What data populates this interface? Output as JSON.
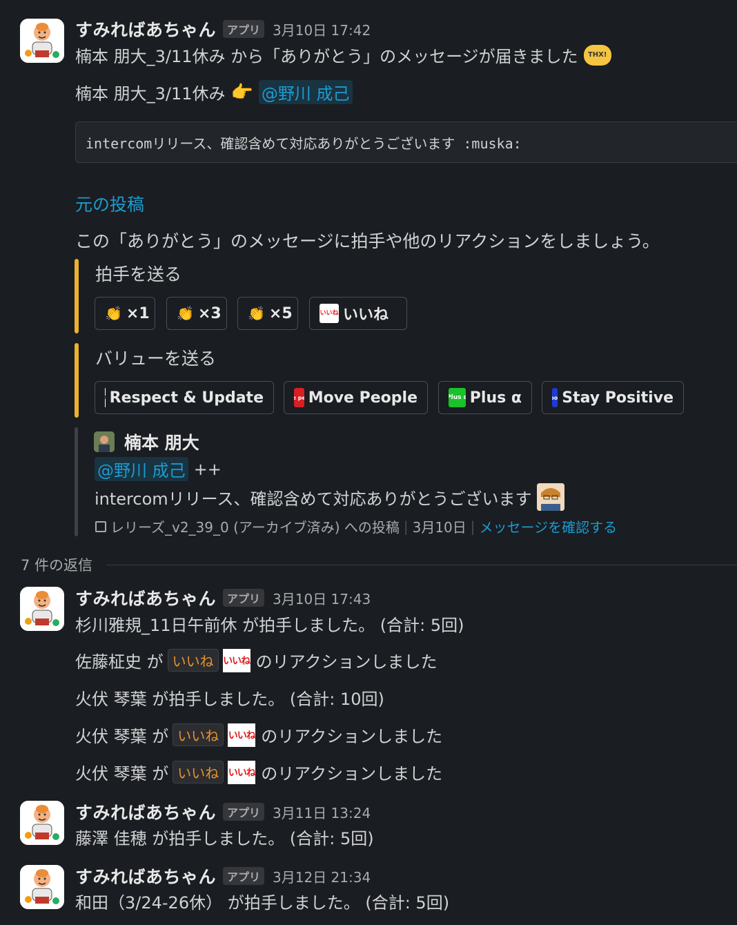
{
  "bot": {
    "name": "すみればあちゃん",
    "tag": "アプリ"
  },
  "main_message": {
    "time": "3月10日 17:42",
    "intro": "楠本 朋大_3/11休み から「ありがとう」のメッセージが届きました",
    "intro_emoji": "THX!",
    "from_name": "楠本 朋大_3/11休み",
    "pointing_emoji": "👉",
    "to_mention": "@野川 成己",
    "code_text": "intercomリリース、確認含めて対応ありがとうございます :muska:",
    "original_link": "元の投稿",
    "prompt": "この「ありがとう」のメッセージに拍手や他のリアクションをしましょう。",
    "clap_section": {
      "title": "拍手を送る",
      "buttons": [
        {
          "emoji": "👏",
          "label": "×1"
        },
        {
          "emoji": "👏",
          "label": "×3"
        },
        {
          "emoji": "👏",
          "label": "×5"
        },
        {
          "emoji": "iine",
          "emoji_text": "いいね",
          "label": "いいね"
        }
      ]
    },
    "value_section": {
      "title": "バリューを送る",
      "buttons": [
        {
          "emoji_text": "Respect & Update",
          "label": "Respect & Update"
        },
        {
          "emoji_text": "move people",
          "label": "Move People"
        },
        {
          "emoji_text": "Plus α",
          "label": "Plus α"
        },
        {
          "emoji_text": "stay positive",
          "label": "Stay Positive"
        }
      ]
    },
    "quote": {
      "author": "楠本 朋大",
      "mention": "@野川 成己",
      "suffix": "++",
      "text": "intercomリリース、確認含めて対応ありがとうございます",
      "footer_channel": "レリーズ_v2_39_0 (アーカイブ済み) への投稿",
      "footer_date": "3月10日",
      "footer_link": "メッセージを確認する"
    }
  },
  "replies_label": "7 件の返信",
  "replies": [
    {
      "time": "3月10日 17:43",
      "lines": [
        {
          "pre": "杉川雅規_11日午前休 が拍手しました。 (合計: 5回)"
        },
        {
          "pre": "佐藤柾史 が",
          "code": "いいね",
          "post": "のリアクションしました"
        },
        {
          "pre": "火伏 琴葉 が拍手しました。 (合計: 10回)"
        },
        {
          "pre": "火伏 琴葉 が",
          "code": "いいね",
          "post": "のリアクションしました"
        },
        {
          "pre": "火伏 琴葉 が",
          "code": "いいね",
          "post": "のリアクションしました"
        }
      ]
    },
    {
      "time": "3月11日 13:24",
      "lines": [
        {
          "pre": "藤澤 佳穂 が拍手しました。 (合計: 5回)"
        }
      ]
    },
    {
      "time": "3月12日 21:34",
      "lines": [
        {
          "pre": "和田（3/24-26休） が拍手しました。 (合計: 5回)"
        }
      ]
    }
  ],
  "colors": {
    "background": "#1a1d21",
    "accent_bar": "#ecb22e",
    "link": "#1d9bd1",
    "code_inline": "#e8912d"
  }
}
